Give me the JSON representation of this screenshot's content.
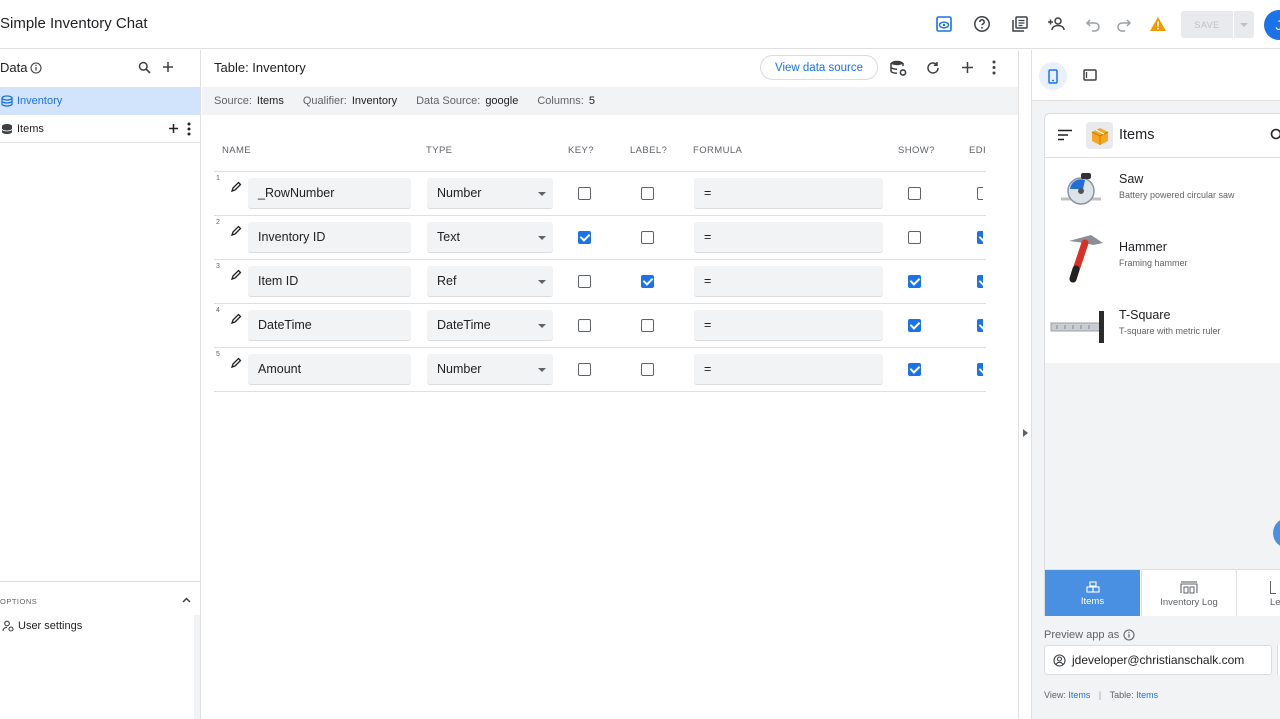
{
  "app": {
    "title": "Simple Inventory Chat",
    "save_label": "SAVE",
    "avatar_initial": "J",
    "toolbar_icons": [
      "preview-icon",
      "help-icon",
      "docs-icon",
      "share-icon",
      "undo-icon",
      "redo-icon",
      "warning-icon"
    ],
    "warning_color": "#f29900",
    "accent": "#1a73e8"
  },
  "sidebar": {
    "title": "Data",
    "tables": [
      {
        "label": "Inventory",
        "selected": true
      },
      {
        "label": "Items",
        "selected": false
      }
    ],
    "options_label": "OPTIONS",
    "user_settings": "User settings"
  },
  "main": {
    "table_title": "Table: Inventory",
    "view_data_source": "View data source",
    "info": {
      "source_k": "Source:",
      "source_v": "Items",
      "qualifier_k": "Qualifier:",
      "qualifier_v": "Inventory",
      "datasource_k": "Data Source:",
      "datasource_v": "google",
      "columns_k": "Columns:",
      "columns_v": "5"
    },
    "headers": {
      "name": "NAME",
      "type": "TYPE",
      "key": "KEY?",
      "label": "LABEL?",
      "formula": "FORMULA",
      "show": "SHOW?",
      "edit": "EDI"
    },
    "rows": [
      {
        "num": "1",
        "name": "_RowNumber",
        "type": "Number",
        "formula": "=",
        "key": false,
        "label": false,
        "show": false,
        "edit": false
      },
      {
        "num": "2",
        "name": "Inventory ID",
        "type": "Text",
        "formula": "=",
        "key": true,
        "label": false,
        "show": false,
        "edit": true
      },
      {
        "num": "3",
        "name": "Item ID",
        "type": "Ref",
        "formula": "=",
        "key": false,
        "label": true,
        "show": true,
        "edit": true
      },
      {
        "num": "4",
        "name": "DateTime",
        "type": "DateTime",
        "formula": "=",
        "key": false,
        "label": false,
        "show": true,
        "edit": true
      },
      {
        "num": "5",
        "name": "Amount",
        "type": "Number",
        "formula": "=",
        "key": false,
        "label": false,
        "show": true,
        "edit": true
      }
    ]
  },
  "preview": {
    "view_title": "Items",
    "items": [
      {
        "name": "Saw",
        "desc": "Battery powered circular saw",
        "icon": "saw-image"
      },
      {
        "name": "Hammer",
        "desc": "Framing hammer",
        "icon": "hammer-image"
      },
      {
        "name": "T-Square",
        "desc": "T-square with metric ruler",
        "icon": "tsquare-image"
      }
    ],
    "nav": [
      {
        "label": "Items",
        "active": true
      },
      {
        "label": "Inventory Log",
        "active": false
      },
      {
        "label": "Le",
        "active": false
      }
    ],
    "preview_as_label": "Preview app as",
    "preview_user": "jdeveloper@christianschalk.com",
    "view_k": "View:",
    "view_v": "Items",
    "table_k": "Table:",
    "table_v": "Items"
  }
}
